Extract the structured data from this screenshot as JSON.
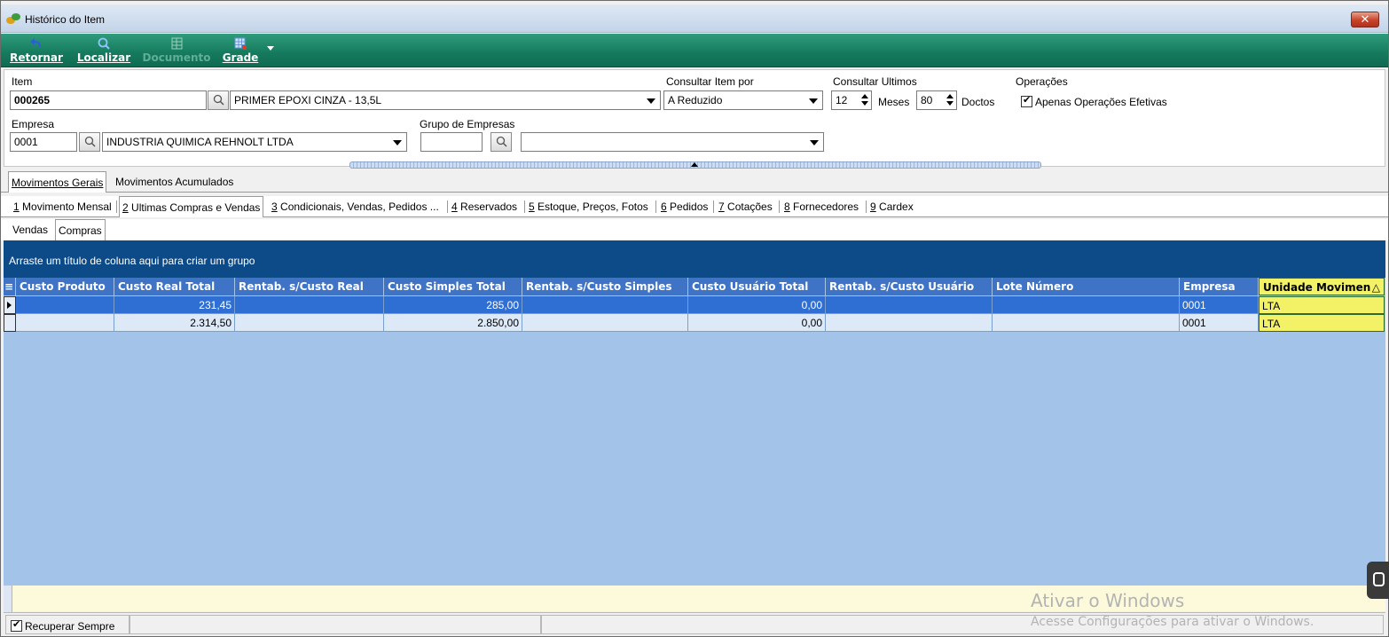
{
  "window": {
    "title": "Histórico do Item",
    "close_glyph": "✕"
  },
  "toolbar": {
    "buttons": [
      {
        "label": "Retornar",
        "icon": "back-arrow-icon"
      },
      {
        "label": "Localizar",
        "icon": "search-icon"
      },
      {
        "label": "Documento",
        "icon": "document-icon",
        "disabled": true
      },
      {
        "label": "Grade",
        "icon": "grid-icon"
      }
    ]
  },
  "filter": {
    "item_label": "Item",
    "item_code": "000265",
    "item_desc": "PRIMER EPOXI CINZA - 13,5L",
    "consult_by_label": "Consultar Item por",
    "consult_by_value": "A Reduzido",
    "consult_last_label": "Consultar Ultimos",
    "months_value": "12",
    "months_label": "Meses",
    "docs_value": "80",
    "docs_label": "Doctos",
    "operations_label": "Operações",
    "only_effective_label": "Apenas Operações Efetivas",
    "company_label": "Empresa",
    "company_code": "0001",
    "company_name": "INDUSTRIA QUIMICA REHNOLT LTDA",
    "company_group_label": "Grupo de Empresas",
    "company_group_code": "",
    "company_group_name": ""
  },
  "tabs_main": [
    "Movimentos Gerais",
    "Movimentos Acumulados"
  ],
  "tabs_sub": [
    {
      "key": "1",
      "label": " Movimento Mensal"
    },
    {
      "key": "2",
      "label": " Ultimas Compras e Vendas"
    },
    {
      "key": "3",
      "label": " Condicionais, Vendas, Pedidos ..."
    },
    {
      "key": "4",
      "label": " Reservados"
    },
    {
      "key": "5",
      "label": " Estoque, Preços, Fotos"
    },
    {
      "key": "6",
      "label": " Pedidos"
    },
    {
      "key": "7",
      "label": " Cotações"
    },
    {
      "key": "8",
      "label": " Fornecedores"
    },
    {
      "key": "9",
      "label": " Cardex"
    }
  ],
  "tabs_inner": [
    "Vendas",
    "Compras"
  ],
  "grid": {
    "group_hint": "Arraste um título de coluna aqui para criar um grupo",
    "columns": [
      "Custo Produto",
      "Custo Real Total",
      "Rentab. s/Custo Real",
      "Custo Simples Total",
      "Rentab. s/Custo Simples",
      "Custo Usuário Total",
      "Rentab. s/Custo Usuário",
      "Lote Número",
      "Empresa",
      "Unidade Movimen"
    ],
    "sort_glyph": "△",
    "rows": [
      [
        "",
        "231,45",
        "",
        "285,00",
        "",
        "0,00",
        "",
        "",
        "0001",
        "LTA"
      ],
      [
        "",
        "2.314,50",
        "",
        "2.850,00",
        "",
        "0,00",
        "",
        "",
        "0001",
        "LTA"
      ]
    ]
  },
  "status": {
    "recover_always_label": "Recuperar Sempre"
  },
  "watermark": {
    "line1": "Ativar o Windows",
    "line2": "Acesse Configurações para ativar o Windows."
  }
}
